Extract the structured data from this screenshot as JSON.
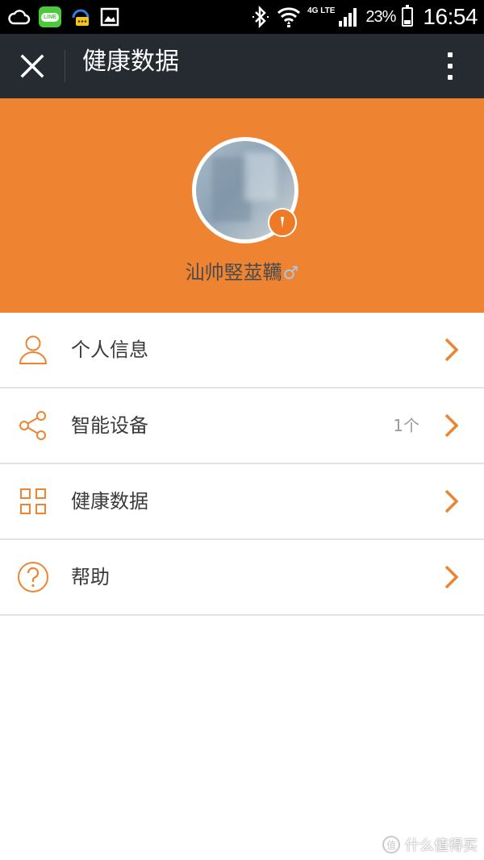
{
  "status_bar": {
    "icons_left": [
      "cloud-icon",
      "line-app-icon",
      "chat-notification-icon",
      "gallery-icon"
    ],
    "line_label": "LINE",
    "icons_right": [
      "bluetooth-icon",
      "wifi-icon",
      "signal-icon",
      "battery-icon"
    ],
    "network_type": "4G LTE",
    "battery_percent": "23%",
    "battery_level": 0.23,
    "time": "16:54"
  },
  "app_bar": {
    "close_icon": "close-icon",
    "title": "健康数据",
    "more_icon": "more-vertical-icon"
  },
  "profile": {
    "username": "汕帅竪莁韉",
    "gender_symbol": "♂",
    "avatar_badge_icon": "vip-badge-icon"
  },
  "menu": {
    "items": [
      {
        "icon": "person-icon",
        "label": "个人信息",
        "value": ""
      },
      {
        "icon": "share-icon",
        "label": "智能设备",
        "value": "1个"
      },
      {
        "icon": "grid-icon",
        "label": "健康数据",
        "value": ""
      },
      {
        "icon": "help-icon",
        "label": "帮助",
        "value": ""
      }
    ]
  },
  "watermark": {
    "logo": "值",
    "text": "什么值得买"
  },
  "colors": {
    "accent": "#ee8432",
    "app_bar": "#252b30"
  }
}
